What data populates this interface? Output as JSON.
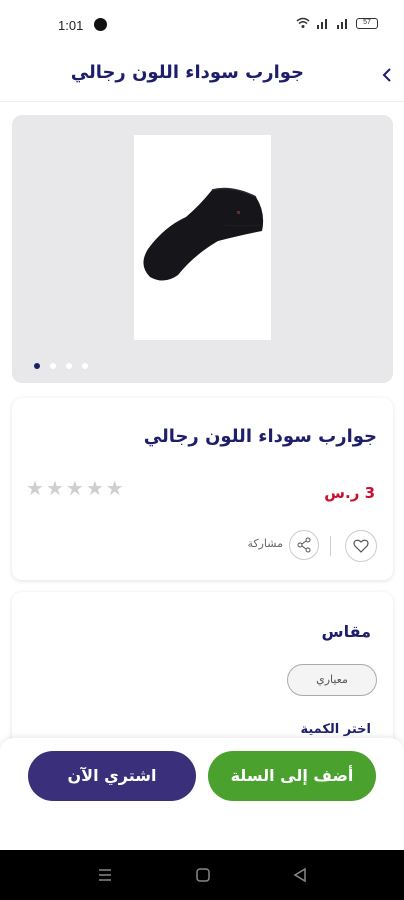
{
  "status": {
    "time": "1:01",
    "battery": "57"
  },
  "header": {
    "title": "جوارب سوداء اللون رجالي",
    "back_icon": "chevron-left-icon"
  },
  "gallery": {
    "slide_count": 4,
    "active_index": 0
  },
  "product": {
    "title": "جوارب سوداء اللون رجالي",
    "price": "3 ر.س",
    "rating": 0,
    "rating_max": 5,
    "share_label": "مشاركة",
    "favorite_icon": "heart-icon",
    "share_icon": "share-icon"
  },
  "options": {
    "size_heading": "مقاس",
    "size_value": "معياري",
    "quantity_heading": "اختر الكمية"
  },
  "actions": {
    "add_to_cart": "أضف إلى السلة",
    "buy_now": "اشتري الآن"
  },
  "colors": {
    "primary": "#1e1f6b",
    "price": "#c8102e",
    "cart_button": "#4aa12e",
    "buy_button": "#3a2f7a"
  }
}
